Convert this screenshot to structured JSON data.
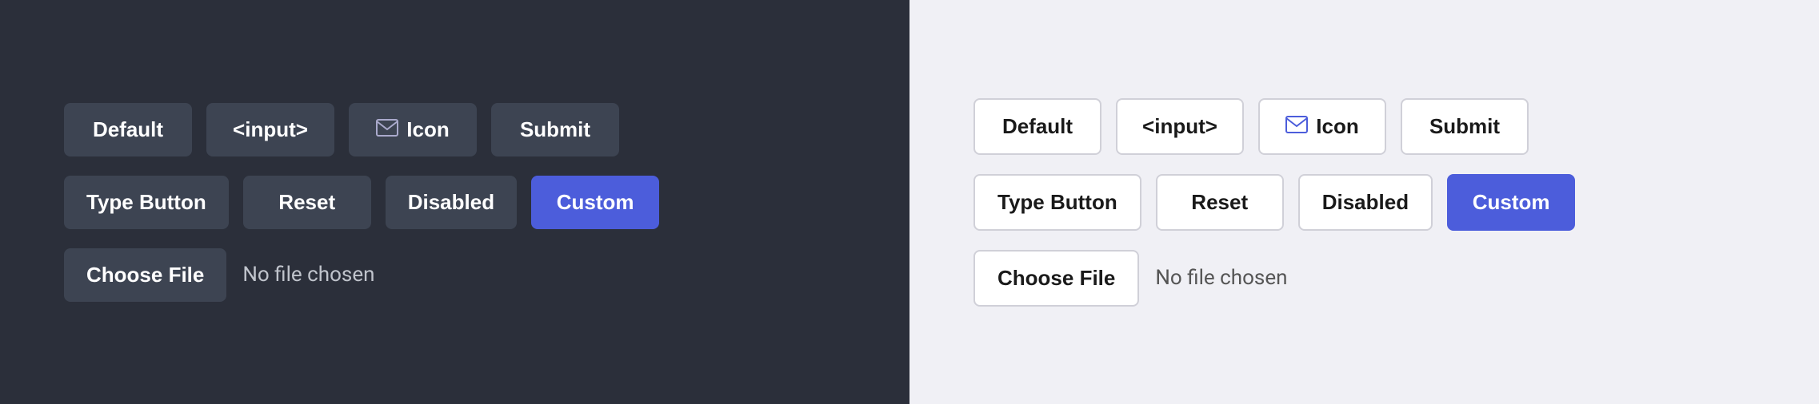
{
  "dark_panel": {
    "row1": [
      {
        "label": "Default",
        "type": "default"
      },
      {
        "label": "<input>",
        "type": "input"
      },
      {
        "label": "Icon",
        "type": "icon"
      },
      {
        "label": "Submit",
        "type": "submit"
      }
    ],
    "row2": [
      {
        "label": "Type Button",
        "type": "type-button"
      },
      {
        "label": "Reset",
        "type": "reset"
      },
      {
        "label": "Disabled",
        "type": "disabled"
      },
      {
        "label": "Custom",
        "type": "custom"
      }
    ],
    "file": {
      "button_label": "Choose File",
      "status_text": "No file chosen"
    }
  },
  "light_panel": {
    "row1": [
      {
        "label": "Default",
        "type": "default"
      },
      {
        "label": "<input>",
        "type": "input"
      },
      {
        "label": "Icon",
        "type": "icon"
      },
      {
        "label": "Submit",
        "type": "submit"
      }
    ],
    "row2": [
      {
        "label": "Type Button",
        "type": "type-button"
      },
      {
        "label": "Reset",
        "type": "reset"
      },
      {
        "label": "Disabled",
        "type": "disabled"
      },
      {
        "label": "Custom",
        "type": "custom"
      }
    ],
    "file": {
      "button_label": "Choose File",
      "status_text": "No file chosen"
    }
  }
}
